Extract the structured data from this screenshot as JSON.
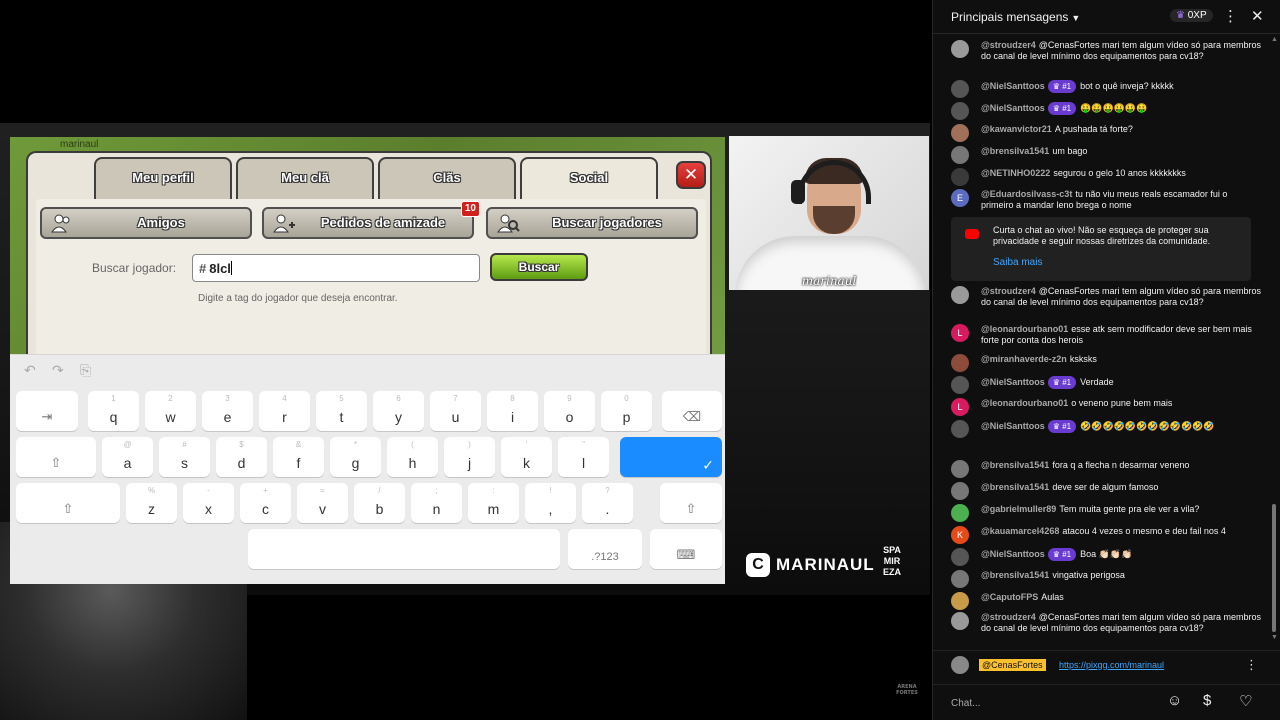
{
  "game": {
    "tabs": [
      "Meu perfil",
      "Meu clã",
      "Clãs",
      "Social"
    ],
    "active_tab": "Social",
    "close_label": "✕",
    "sub_buttons": {
      "friends": "Amigos",
      "friend_requests": "Pedidos de amizade",
      "friend_requests_badge": "10",
      "search_players": "Buscar jogadores"
    },
    "search_label": "Buscar jogador:",
    "search_prefix": "#",
    "search_value": "8lcl",
    "search_button": "Buscar",
    "search_hint": "Digite a tag do jogador que deseja encontrar.",
    "top_strip_name": "marinaul"
  },
  "keyboard": {
    "toolbar": [
      "↶",
      "↷",
      "⎘"
    ],
    "row1": [
      {
        "ch": "q",
        "hint": "1"
      },
      {
        "ch": "w",
        "hint": "2"
      },
      {
        "ch": "e",
        "hint": "3"
      },
      {
        "ch": "r",
        "hint": "4"
      },
      {
        "ch": "t",
        "hint": "5"
      },
      {
        "ch": "y",
        "hint": "6"
      },
      {
        "ch": "u",
        "hint": "7"
      },
      {
        "ch": "i",
        "hint": "8"
      },
      {
        "ch": "o",
        "hint": "9"
      },
      {
        "ch": "p",
        "hint": "0"
      }
    ],
    "row2": [
      {
        "ch": "a",
        "hint": "@"
      },
      {
        "ch": "s",
        "hint": "#"
      },
      {
        "ch": "d",
        "hint": "$"
      },
      {
        "ch": "f",
        "hint": "&"
      },
      {
        "ch": "g",
        "hint": "*"
      },
      {
        "ch": "h",
        "hint": "("
      },
      {
        "ch": "j",
        "hint": ")"
      },
      {
        "ch": "k",
        "hint": "'"
      },
      {
        "ch": "l",
        "hint": "\""
      }
    ],
    "row3": [
      {
        "ch": "z",
        "hint": "%"
      },
      {
        "ch": "x",
        "hint": "-"
      },
      {
        "ch": "c",
        "hint": "+"
      },
      {
        "ch": "v",
        "hint": "="
      },
      {
        "ch": "b",
        "hint": "/"
      },
      {
        "ch": "n",
        "hint": ";"
      },
      {
        "ch": "m",
        "hint": ":"
      },
      {
        "ch": ",",
        "hint": "!"
      },
      {
        "ch": ".",
        "hint": "?"
      }
    ],
    "tab_key": "⇥",
    "backspace_key": "⌫",
    "shift_key": "⇧",
    "enter_key": "✓",
    "symbols_key": ".?123",
    "hide_key": "⌨"
  },
  "stream": {
    "cam_name": "marinaul",
    "brand_letter": "C",
    "brand_name": "MARINAUL",
    "sponsor_lines": [
      "SPA",
      "MIR",
      "EZA"
    ],
    "bottom_logo_lines": [
      "ARENA",
      "FORTES"
    ]
  },
  "chat": {
    "title": "Principais mensagens",
    "xp": "0XP",
    "notice_text": "Curta o chat ao vivo! Não se esqueça de proteger sua privacidade e seguir nossas diretrizes da comunidade.",
    "notice_link": "Saiba mais",
    "messages": [
      {
        "author": "@stroudzer4",
        "rank": "",
        "text": "@CenasFortes mari tem algum vídeo só para membros do canal de level mínimo dos equipamentos para cv18?",
        "avatar": "#9a9a9a",
        "initial": ""
      },
      {
        "author": "@NielSanttoos",
        "rank": "#1",
        "text": "bot o quê inveja? kkkkk",
        "avatar": "#555555",
        "initial": ""
      },
      {
        "author": "@NielSanttoos",
        "rank": "#1",
        "text": "🤑🤑🤑🤑🤑🤑",
        "avatar": "#555555",
        "initial": ""
      },
      {
        "author": "@kawanvictor21",
        "rank": "",
        "text": "A pushada tá forte?",
        "avatar": "#a0705a",
        "initial": ""
      },
      {
        "author": "@brensilva1541",
        "rank": "",
        "text": "um bago",
        "avatar": "#777777",
        "initial": ""
      },
      {
        "author": "@NETINHO0222",
        "rank": "",
        "text": "segurou o gelo 10 anos kkkkkkks",
        "avatar": "#3a3a3a",
        "initial": ""
      },
      {
        "author": "@Eduardosilvass-c3t",
        "rank": "",
        "text": "tu não viu meus reals escamador fui o primeiro a mandar leno brega o nome",
        "avatar": "#5c6bc0",
        "initial": "E"
      },
      {
        "author": "@stroudzer4",
        "rank": "",
        "text": "@CenasFortes mari tem algum vídeo só para membros do canal de level mínimo dos equipamentos para cv18?",
        "avatar": "#9a9a9a",
        "initial": ""
      },
      {
        "author": "@leonardourbano01",
        "rank": "",
        "text": "esse atk sem modificador deve ser bem mais forte por conta dos herois",
        "avatar": "#d81b60",
        "initial": "L"
      },
      {
        "author": "@miranhaverde-z2n",
        "rank": "",
        "text": "ksksks",
        "avatar": "#8d4b3b",
        "initial": ""
      },
      {
        "author": "@NielSanttoos",
        "rank": "#1",
        "text": "Verdade",
        "avatar": "#555555",
        "initial": ""
      },
      {
        "author": "@leonardourbano01",
        "rank": "",
        "text": "o veneno pune bem mais",
        "avatar": "#d81b60",
        "initial": "L"
      },
      {
        "author": "@NielSanttoos",
        "rank": "#1",
        "text": "🤣🤣🤣🤣🤣🤣🤣🤣🤣🤣🤣🤣",
        "avatar": "#555555",
        "initial": ""
      },
      {
        "author": "@brensilva1541",
        "rank": "",
        "text": "fora q a flecha n desarmar veneno",
        "avatar": "#777777",
        "initial": ""
      },
      {
        "author": "@brensilva1541",
        "rank": "",
        "text": "deve ser de algum famoso",
        "avatar": "#777777",
        "initial": ""
      },
      {
        "author": "@gabrielmuller89",
        "rank": "",
        "text": "Tem muita gente pra ele ver a vila?",
        "avatar": "#4caf50",
        "initial": ""
      },
      {
        "author": "@kauamarcel4268",
        "rank": "",
        "text": "atacou 4 vezes o mesmo e deu fail nos 4",
        "avatar": "#e64a19",
        "initial": "K"
      },
      {
        "author": "@NielSanttoos",
        "rank": "#1",
        "text": "Boa 👏🏻👏🏻👏🏻",
        "avatar": "#555555",
        "initial": ""
      },
      {
        "author": "@brensilva1541",
        "rank": "",
        "text": "vingativa perigosa",
        "avatar": "#777777",
        "initial": ""
      },
      {
        "author": "@CaputoFPS",
        "rank": "",
        "text": "Aulas",
        "avatar": "#c79a4a",
        "initial": ""
      },
      {
        "author": "@stroudzer4",
        "rank": "",
        "text": "@CenasFortes mari tem algum vídeo só para membros do canal de level mínimo dos equipamentos para cv18?",
        "avatar": "#9a9a9a",
        "initial": ""
      }
    ],
    "pinned": {
      "tag": "@CenasFortes",
      "link": "https://pixgg.com/marinaul"
    },
    "input_placeholder": "Chat..."
  }
}
